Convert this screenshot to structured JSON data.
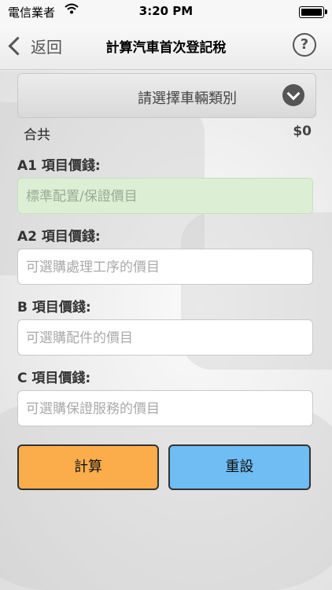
{
  "status": {
    "carrier": "電信業者",
    "time": "3:20 PM"
  },
  "nav": {
    "back_label": "返回",
    "title": "計算汽車首次登記稅",
    "help_label": "?"
  },
  "selector": {
    "label": "請選擇車輛類別"
  },
  "total": {
    "label": "合共",
    "value": "$0"
  },
  "fields": [
    {
      "label": "A1 項目價錢:",
      "placeholder": "標準配置/保證價目"
    },
    {
      "label": "A2 項目價錢:",
      "placeholder": "可選購處理工序的價目"
    },
    {
      "label": "B 項目價錢:",
      "placeholder": "可選購配件的價目"
    },
    {
      "label": "C 項目價錢:",
      "placeholder": "可選購保證服務的價目"
    }
  ],
  "buttons": {
    "calculate": "計算",
    "reset": "重設"
  },
  "colors": {
    "calculate": "#fbad4c",
    "reset": "#6fbdf3",
    "field_highlight": "#dcefd5"
  }
}
